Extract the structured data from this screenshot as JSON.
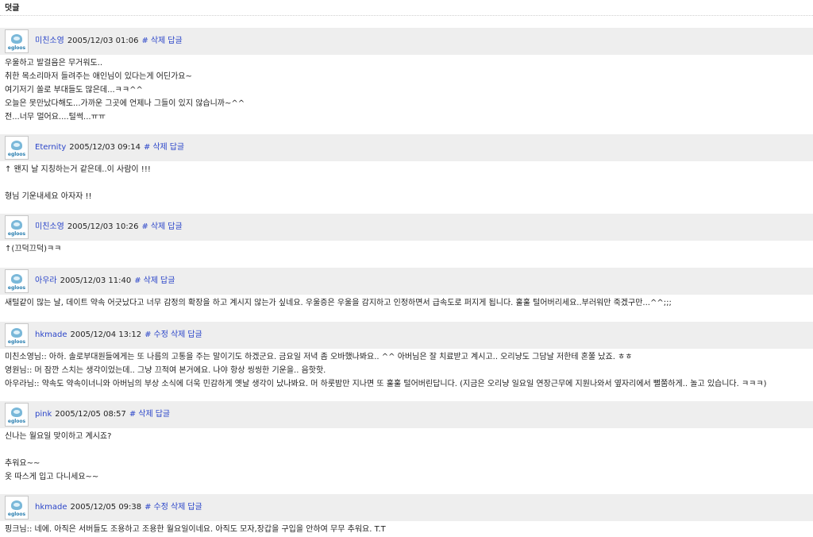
{
  "section_title": "덧글",
  "avatar_logo": "egloos",
  "comments": [
    {
      "author": "미친소영",
      "date": "2005/12/03 01:06",
      "actions": [
        "#",
        "삭제",
        "답글"
      ],
      "lines": [
        "우울하고 발걸음은 무거워도..",
        "취한 목소리마저 들려주는 애인님이 있다는게 어딘가요~",
        "여기저기 쏠로 부대들도 많은데...ㅋㅋ^^",
        "오늘은 못만났다해도...가까운 그곳에 언제나 그들이 있지 않습니까~^^",
        "전...너무 멀어요....털썩...ㅠㅠ"
      ]
    },
    {
      "author": "Eternity",
      "date": "2005/12/03 09:14",
      "actions": [
        "#",
        "삭제",
        "답글"
      ],
      "lines": [
        "↑ 왠지 날 지칭하는거 같은데..이 사람이 !!!",
        "",
        "형님 기운내세요 아자자 !!"
      ]
    },
    {
      "author": "미친소영",
      "date": "2005/12/03 10:26",
      "actions": [
        "#",
        "삭제",
        "답글"
      ],
      "lines": [
        "↑(끄덕끄덕)ㅋㅋ"
      ]
    },
    {
      "author": "아우라",
      "date": "2005/12/03 11:40",
      "actions": [
        "#",
        "삭제",
        "답글"
      ],
      "lines": [
        "새털같이 많는 날, 데이트 약속 어긋났다고 너무 감정의 확장을 하고 계시지 않는가 싶네요. 우울증은 우울을 감지하고 인정하면서 급속도로 퍼지게 됩니다. 훌훌 털어버리세요..부러워만 죽겠구만...^^;;;"
      ]
    },
    {
      "author": "hkmade",
      "date": "2005/12/04 13:12",
      "actions": [
        "#",
        "수정",
        "삭제",
        "답글"
      ],
      "lines": [
        "미친소영님:: 아하. 솔로부대원들에게는 또 나름의 고통을 주는 말이기도 하겠군요. 금요일 저녁 좀 오바했나봐요.. ^^ 아버님은 잘 치료받고 계시고.. 오리냥도 그담날 저한테 혼쭐 났죠. ㅎㅎ",
        "영원님:: 머 잠깐 스치는 생각이었는데.. 그냥 끄적여 본거에요. 나야 항상 씽씽한 기운을.. 음핫핫.",
        "아우라님:: 약속도 약속이너니와 아버님의 부상 소식에 더욱 민감하게 옛날 생각이 났나봐요. 머 하룻밤만 지나면 또 훌훌 털어버린답니다. (지금은 오리냥 일요일 연장근무에 지원나와서 옆자리에서 뻘쭘하게.. 놀고 있습니다. ㅋㅋㅋ)"
      ]
    },
    {
      "author": "pink",
      "date": "2005/12/05 08:57",
      "actions": [
        "#",
        "삭제",
        "답글"
      ],
      "lines": [
        "신나는 월요일 맞이하고 계시죠?",
        "",
        "추워요~~",
        "옷 따스게 입고 다니세요~~"
      ]
    },
    {
      "author": "hkmade",
      "date": "2005/12/05 09:38",
      "actions": [
        "#",
        "수정",
        "삭제",
        "답글"
      ],
      "lines": [
        "핑크님:: 네에. 아직은 서버들도 조용하고 조용한 월요일이네요. 아직도 모자,장갑을 구입을 안하여 무무 추워요. T.T"
      ]
    }
  ]
}
